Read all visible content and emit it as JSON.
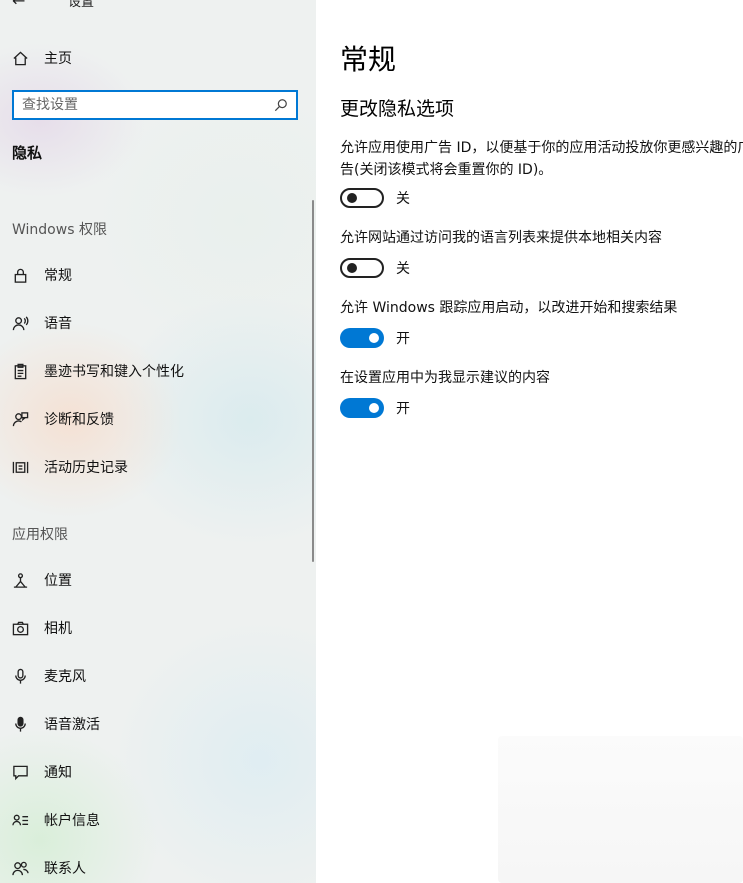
{
  "header": {
    "back_title": "设置"
  },
  "sidebar": {
    "home": "主页",
    "search_placeholder": "查找设置",
    "section_title": "隐私",
    "windows_group": "Windows 权限",
    "windows_items": [
      "常规",
      "语音",
      "墨迹书写和键入个性化",
      "诊断和反馈",
      "活动历史记录"
    ],
    "app_group": "应用权限",
    "app_items": [
      "位置",
      "相机",
      "麦克风",
      "语音激活",
      "通知",
      "帐户信息",
      "联系人"
    ]
  },
  "main": {
    "title": "常规",
    "subtitle": "更改隐私选项",
    "options": [
      {
        "text": "允许应用使用广告 ID，以便基于你的应用活动投放你更感兴趣的广告(关闭该模式将会重置你的 ID)。",
        "state": "关",
        "on": false
      },
      {
        "text": "允许网站通过访问我的语言列表来提供本地相关内容",
        "state": "关",
        "on": false
      },
      {
        "text": "允许 Windows 跟踪应用启动，以改进开始和搜索结果",
        "state": "开",
        "on": true
      },
      {
        "text": "在设置应用中为我显示建议的内容",
        "state": "开",
        "on": true
      }
    ]
  },
  "colors": {
    "accent": "#0078d4"
  },
  "icons": {
    "home": "home-icon",
    "general": "lock-icon",
    "speech": "speech-person-icon",
    "inking": "clipboard-icon",
    "diagnostics": "feedback-person-icon",
    "activity": "timeline-icon",
    "location": "location-icon",
    "camera": "camera-icon",
    "microphone": "microphone-icon",
    "voice": "microphone-filled-icon",
    "notifications": "chat-icon",
    "account": "account-list-icon",
    "contacts": "contacts-icon",
    "search": "search-icon",
    "back": "back-arrow-icon"
  }
}
